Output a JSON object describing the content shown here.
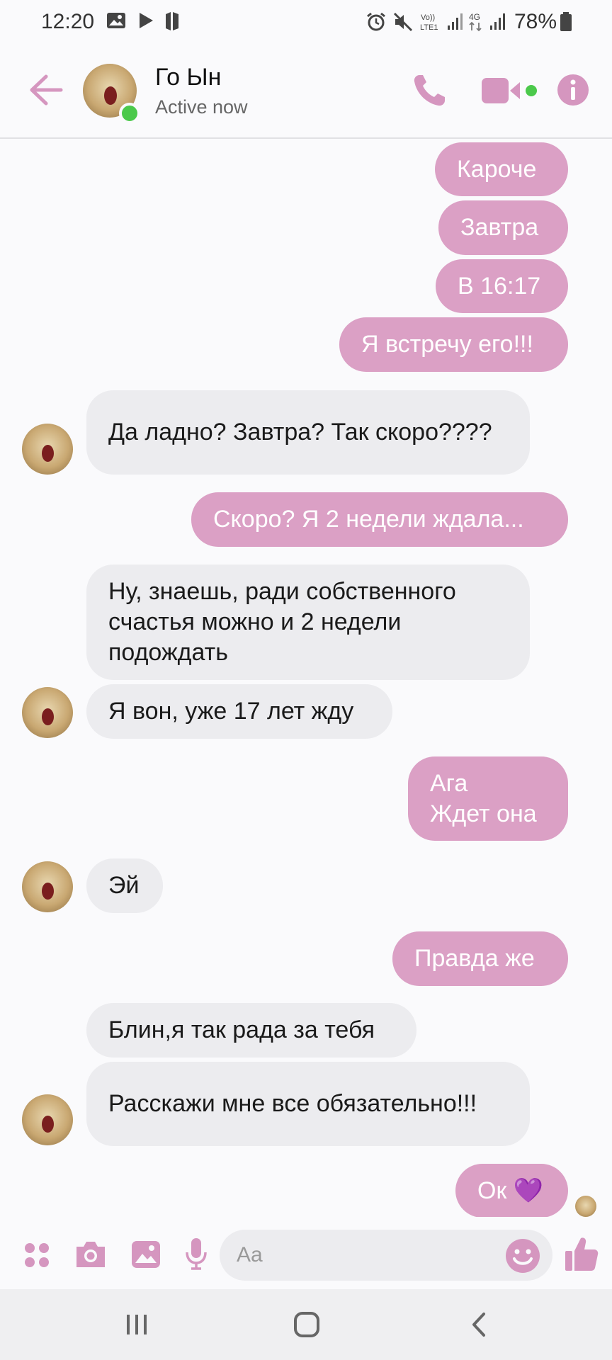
{
  "status_bar": {
    "time": "12:20",
    "battery": "78%",
    "icons": [
      "gallery-icon",
      "play-icon",
      "app-icon",
      "alarm-icon",
      "mute-icon",
      "volte-icon",
      "signal-icon",
      "4g-icon",
      "signal-icon",
      "battery-icon"
    ]
  },
  "header": {
    "contact_name": "Го Ын",
    "status": "Active now",
    "icons": [
      "back-arrow-icon",
      "phone-icon",
      "video-icon",
      "info-icon"
    ]
  },
  "colors": {
    "accent": "#dba0c5",
    "outgoing_bubble": "#dba0c5",
    "incoming_bubble": "#ececef",
    "online": "#4bc94b"
  },
  "messages": [
    {
      "side": "out",
      "text": "Кароче"
    },
    {
      "side": "out",
      "text": "Завтра"
    },
    {
      "side": "out",
      "text": "В 16:17"
    },
    {
      "side": "out",
      "text": "Я встречу его!!!"
    },
    {
      "side": "in",
      "text": "Да ладно? Завтра? Так скоро????"
    },
    {
      "side": "out",
      "text": "Скоро? Я 2 недели ждала..."
    },
    {
      "side": "in",
      "text": "Ну, знаешь, ради собственного счастья можно и 2 недели подождать"
    },
    {
      "side": "in",
      "text": "Я вон, уже 17 лет жду"
    },
    {
      "side": "out",
      "text": "Ага\nЖдет она"
    },
    {
      "side": "in",
      "text": "Эй"
    },
    {
      "side": "out",
      "text": "Правда же"
    },
    {
      "side": "in",
      "text": "Блин,я так рада за тебя"
    },
    {
      "side": "in",
      "text": "Расскажи мне все обязательно!!!"
    },
    {
      "side": "out",
      "text": "Ок 💜"
    }
  ],
  "composer": {
    "placeholder": "Aa",
    "icons": [
      "apps-icon",
      "camera-icon",
      "image-icon",
      "mic-icon",
      "emoji-icon",
      "thumbs-up-icon"
    ]
  },
  "navbar": {
    "icons": [
      "recents-icon",
      "home-icon",
      "back-icon"
    ]
  }
}
